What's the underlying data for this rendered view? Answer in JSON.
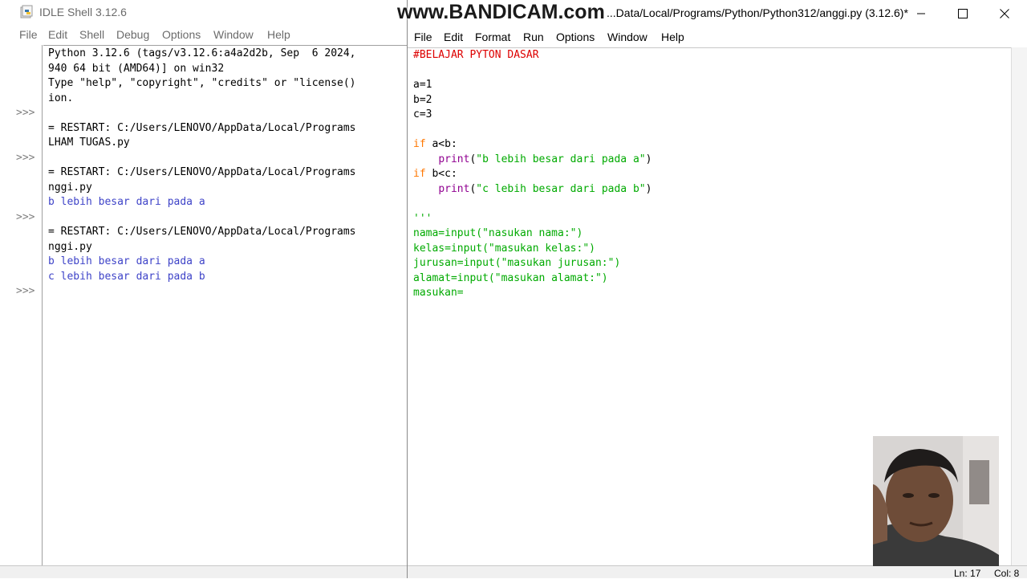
{
  "shell": {
    "title": "IDLE Shell 3.12.6",
    "menu": [
      "File",
      "Edit",
      "Shell",
      "Debug",
      "Options",
      "Window",
      "Help"
    ],
    "prompt": ">>>",
    "lines": [
      {
        "text": "Python 3.12.6 (tags/v3.12.6:a4a2d2b, Sep  6 2024,",
        "kind": "normal"
      },
      {
        "text": "940 64 bit (AMD64)] on win32",
        "kind": "normal"
      },
      {
        "text": "Type \"help\", \"copyright\", \"credits\" or \"license()",
        "kind": "normal"
      },
      {
        "text": "ion.",
        "kind": "normal"
      },
      {
        "text": "",
        "kind": "normal"
      },
      {
        "text": "= RESTART: C:/Users/LENOVO/AppData/Local/Programs",
        "kind": "normal"
      },
      {
        "text": "LHAM TUGAS.py",
        "kind": "normal"
      },
      {
        "text": "",
        "kind": "normal"
      },
      {
        "text": "= RESTART: C:/Users/LENOVO/AppData/Local/Programs",
        "kind": "normal"
      },
      {
        "text": "nggi.py",
        "kind": "normal"
      },
      {
        "text": "b lebih besar dari pada a",
        "kind": "output"
      },
      {
        "text": "",
        "kind": "normal"
      },
      {
        "text": "= RESTART: C:/Users/LENOVO/AppData/Local/Programs",
        "kind": "normal"
      },
      {
        "text": "nggi.py",
        "kind": "normal"
      },
      {
        "text": "b lebih besar dari pada a",
        "kind": "output"
      },
      {
        "text": "c lebih besar dari pada b",
        "kind": "output"
      },
      {
        "text": "",
        "kind": "normal"
      }
    ],
    "prompt_rows": [
      4,
      7,
      11,
      16
    ]
  },
  "editor": {
    "watermark": "www.BANDICAM.com",
    "title": "...Data/Local/Programs/Python/Python312/anggi.py (3.12.6)*",
    "menu": [
      "File",
      "Edit",
      "Format",
      "Run",
      "Options",
      "Window",
      "Help"
    ],
    "code": [
      [
        {
          "t": "#BELAJAR PYTON DASAR",
          "c": "comment"
        }
      ],
      [],
      [
        {
          "t": "a=1",
          "c": "default"
        }
      ],
      [
        {
          "t": "b=2",
          "c": "default"
        }
      ],
      [
        {
          "t": "c=3",
          "c": "default"
        }
      ],
      [],
      [
        {
          "t": "if",
          "c": "keyword"
        },
        {
          "t": " a<b:",
          "c": "default"
        }
      ],
      [
        {
          "t": "    ",
          "c": "default"
        },
        {
          "t": "print",
          "c": "builtin"
        },
        {
          "t": "(",
          "c": "default"
        },
        {
          "t": "\"b lebih besar dari pada a\"",
          "c": "string"
        },
        {
          "t": ")",
          "c": "default"
        }
      ],
      [
        {
          "t": "if",
          "c": "keyword"
        },
        {
          "t": " b<c:",
          "c": "default"
        }
      ],
      [
        {
          "t": "    ",
          "c": "default"
        },
        {
          "t": "print",
          "c": "builtin"
        },
        {
          "t": "(",
          "c": "default"
        },
        {
          "t": "\"c lebih besar dari pada b\"",
          "c": "string"
        },
        {
          "t": ")",
          "c": "default"
        }
      ],
      [],
      [
        {
          "t": "'''",
          "c": "string"
        }
      ],
      [
        {
          "t": "nama=input(\"nasukan nama:\")",
          "c": "string"
        }
      ],
      [
        {
          "t": "kelas=input(\"masukan kelas:\")",
          "c": "string"
        }
      ],
      [
        {
          "t": "jurusan=input(\"masukan jurusan:\")",
          "c": "string"
        }
      ],
      [
        {
          "t": "alamat=input(\"masukan alamat:\")",
          "c": "string"
        }
      ],
      [
        {
          "t": "masukan=",
          "c": "string"
        }
      ]
    ],
    "status": {
      "line": "Ln: 17",
      "col": "Col: 8"
    }
  }
}
